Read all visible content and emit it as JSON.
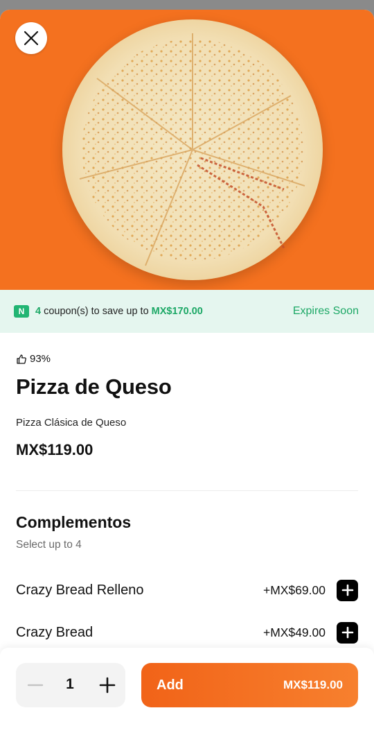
{
  "hero": {
    "image": "cheese-pizza-photo",
    "background": "#f4711f"
  },
  "coupon": {
    "badge": "N",
    "count": "4",
    "text_mid": " coupon(s) to save up to ",
    "amount": "MX$170.00",
    "expires": "Expires Soon"
  },
  "product": {
    "rating": "93%",
    "title": "Pizza de Queso",
    "description": "Pizza Clásica de Queso",
    "price": "MX$119.00"
  },
  "addons": {
    "title": "Complementos",
    "subtitle": "Select up to 4",
    "items": [
      {
        "name": "Crazy Bread Relleno",
        "price": "+MX$69.00"
      },
      {
        "name": "Crazy Bread",
        "price": "+MX$49.00"
      }
    ]
  },
  "footer": {
    "quantity": "1",
    "add_label": "Add",
    "add_price": "MX$119.00"
  },
  "colors": {
    "accent": "#f16318",
    "coupon_green": "#1da866",
    "coupon_bg": "#e5f6ef"
  }
}
